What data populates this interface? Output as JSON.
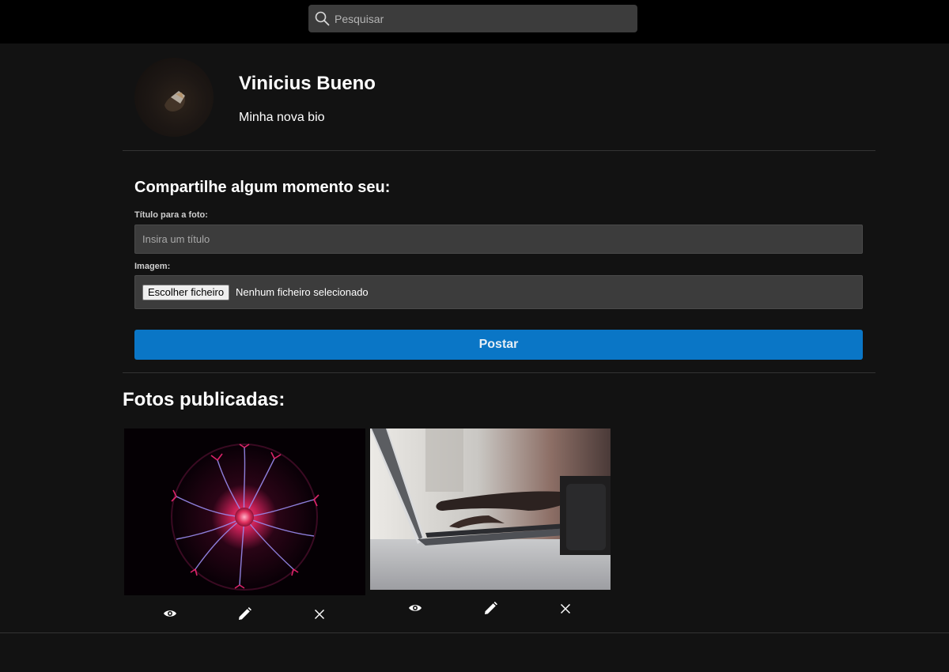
{
  "search": {
    "placeholder": "Pesquisar"
  },
  "profile": {
    "name": "Vinicius Bueno",
    "bio": "Minha nova bio"
  },
  "share_form": {
    "heading": "Compartilhe algum momento seu:",
    "title_label": "Título para a foto:",
    "title_placeholder": "Insira um título",
    "image_label": "Imagem:",
    "file_button_label": "Escolher ficheiro",
    "file_status": "Nenhum ficheiro selecionado",
    "submit_label": "Postar"
  },
  "photos": {
    "heading": "Fotos publicadas:",
    "items": [
      {
        "image": "plasma-ball-photo",
        "actions": [
          "eye-icon",
          "pencil-icon",
          "close-icon"
        ]
      },
      {
        "image": "laptop-typing-photo",
        "actions": [
          "eye-icon",
          "pencil-icon",
          "close-icon"
        ]
      }
    ]
  },
  "colors": {
    "page_background": "#121212",
    "topbar_background": "#000000",
    "input_background": "#3c3c3c",
    "primary_button": "#0a76c6"
  }
}
